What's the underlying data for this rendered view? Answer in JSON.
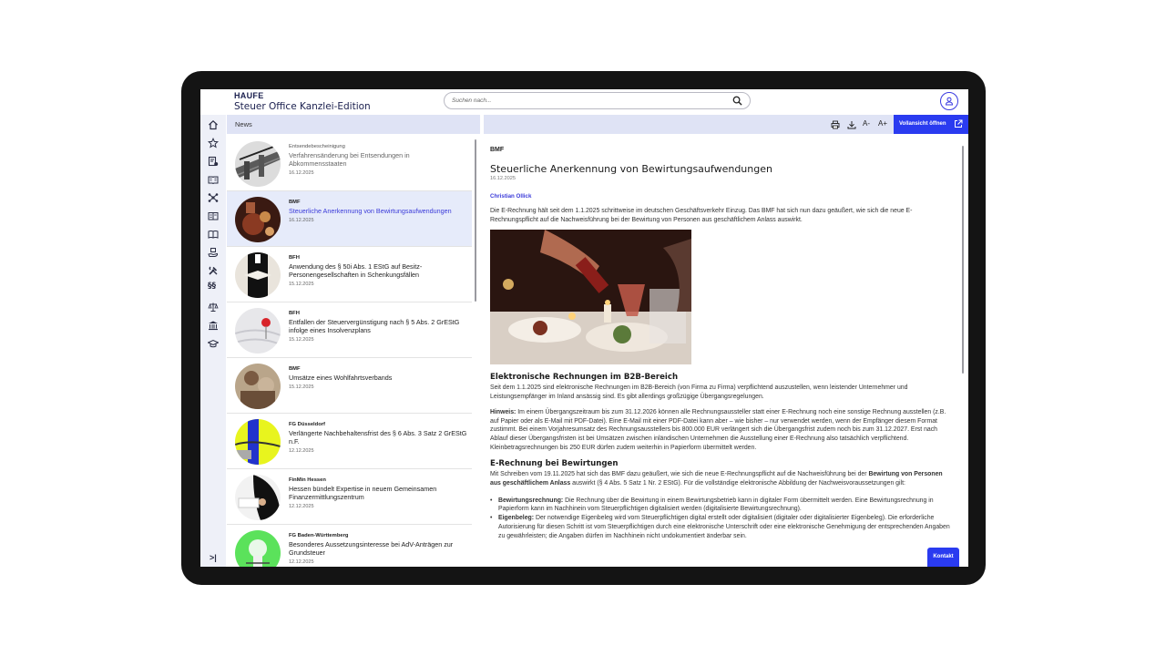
{
  "header": {
    "logo": "HAUFE",
    "product": "Steuer Office Kanzlei-Edition",
    "search_placeholder": "Suchen nach..."
  },
  "sidebar": {
    "icons": [
      "home-icon",
      "star-icon",
      "document-settings-icon",
      "book-open-icon",
      "network-icon",
      "reader-icon",
      "book-icon",
      "box-hand-icon",
      "tools-icon",
      "paragraph-icon",
      "scale-icon",
      "bank-icon",
      "graduation-icon"
    ],
    "collapse_label": ">|"
  },
  "news": {
    "heading": "News",
    "items": [
      {
        "source": "Entsendebescheinigung",
        "title": "Verfahrensänderung bei Entsendungen in Abkommensstaaten",
        "date": "16.12.2025",
        "style": "muted"
      },
      {
        "source": "BMF",
        "title": "Steuerliche Anerkennung von Bewirtungsaufwendungen",
        "date": "16.12.2025",
        "style": "selected"
      },
      {
        "source": "BFH",
        "title": "Anwendung des § 50i Abs. 1 EStG auf Besitz-Personengesellschaften in Schenkungsfällen",
        "date": "15.12.2025",
        "style": "normal"
      },
      {
        "source": "BFH",
        "title": "Entfallen der Steuervergünstigung nach § 5 Abs. 2 GrEStG infolge eines Insolvenzplans",
        "date": "15.12.2025",
        "style": "normal"
      },
      {
        "source": "BMF",
        "title": "Umsätze eines Wohlfahrtsverbands",
        "date": "15.12.2025",
        "style": "normal"
      },
      {
        "source": "FG Düsseldorf",
        "title": "Verlängerte Nachbehaltensfrist des § 6 Abs. 3 Satz 2 GrEStG n.F.",
        "date": "12.12.2025",
        "style": "normal"
      },
      {
        "source": "FinMin Hessen",
        "title": "Hessen bündelt Expertise in neuem Gemeinsamen Finanzermittlungszentrum",
        "date": "12.12.2025",
        "style": "normal"
      },
      {
        "source": "FG Baden-Württemberg",
        "title": "Besonderes Aussetzungsinteresse bei AdV-Anträgen zur Grundsteuer",
        "date": "12.12.2025",
        "style": "normal"
      }
    ]
  },
  "toolbar": {
    "decrease_font": "A-",
    "increase_font": "A+",
    "fullview_label": "Vollansicht öffnen"
  },
  "article": {
    "source": "BMF",
    "title": "Steuerliche Anerkennung von Bewirtungsaufwendungen",
    "date": "16.12.2025",
    "author": "Christian Ollick",
    "intro": "Die E-Rechnung hält seit dem 1.1.2025 schrittweise im deutschen Geschäftsverkehr Einzug. Das BMF hat sich nun dazu geäußert, wie sich die neue E-Rechnungspflicht auf die Nachweisführung bei der Bewirtung von Personen aus geschäftlichem Anlass auswirkt.",
    "h1": "Elektronische Rechnungen im B2B-Bereich",
    "p1": "Seit dem 1.1.2025 sind elektronische Rechnungen im B2B-Bereich (von Firma zu Firma) verpflichtend auszustellen, wenn leistender Unternehmer und Leistungsempfänger im Inland ansässig sind. Es gibt allerdings großzügige Übergangsregelungen.",
    "hint_label": "Hinweis:",
    "hint": " Im einem Übergangszeitraum bis zum 31.12.2026 können alle Rechnungsaussteller statt einer E-Rechnung noch eine sonstige Rechnung ausstellen (z.B. auf Papier oder als E-Mail mit PDF-Datei). Eine E-Mail mit einer PDF-Datei kann aber – wie bisher – nur verwendet werden, wenn der Empfänger diesem Format zustimmt. Bei einem Vorjahresumsatz des Rechnungsausstellers bis 800.000 EUR verlängert sich die Übergangsfrist zudem noch bis zum 31.12.2027. Erst nach Ablauf dieser Übergangsfristen ist bei Umsätzen zwischen inländischen Unternehmen die Ausstellung einer E-Rechnung also tatsächlich verpflichtend. Kleinbetragsrechnungen bis 250 EUR dürfen zudem weiterhin in Papierform übermittelt werden.",
    "h2": "E-Rechnung bei Bewirtungen",
    "p2a": "Mit Schreiben vom 19.11.2025 hat sich das BMF dazu geäußert, wie sich die neue E-Rechnungspflicht auf die Nachweisführung bei der ",
    "p2b": "Bewirtung von Personen aus geschäftlichem Anlass",
    "p2c": " auswirkt (§ 4 Abs. 5 Satz 1 Nr. 2 EStG). Für die vollständige elektronische Abbildung der Nachweisvoraussetzungen gilt:",
    "b1_label": "Bewirtungsrechnung:",
    "b1": " Die Rechnung über die Bewirtung in einem Bewirtungsbetrieb kann in digitaler Form übermittelt werden. Eine Bewirtungsrechnung in Papierform kann im Nachhinein vom Steuerpflichtigen digitalisiert werden (digitalisierte Bewirtungsrechnung).",
    "b2_label": "Eigenbeleg:",
    "b2": " Der notwendige Eigenbeleg wird vom Steuerpflichtigen digital erstellt oder digitalisiert (digitaler oder digitalisierter Eigenbeleg). Die erforderliche Autorisierung für diesen Schritt ist vom Steuerpflichtigen durch eine elektronische Unterschrift oder eine elektronische Genehmigung der entsprechenden Angaben zu gewährleisten; die Angaben dürfen im Nachhinein nicht undokumentiert änderbar sein."
  },
  "contact_label": "Kontakt",
  "colors": {
    "accent": "#2a3bf0",
    "link": "#3a3ad9",
    "panel": "#dfe3f5",
    "sidebar": "#eef0f8"
  }
}
